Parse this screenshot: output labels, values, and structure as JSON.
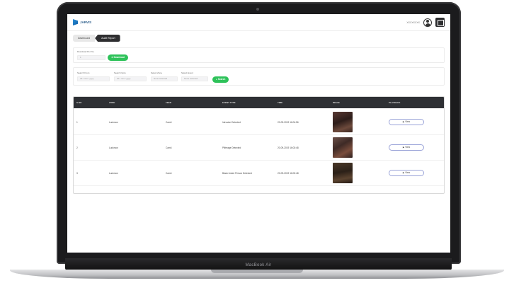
{
  "device": {
    "brand": "MacBook Air"
  },
  "app": {
    "name": "JARVIS",
    "user_label": "XXXXXXXX"
  },
  "breadcrumb": {
    "items": [
      "Dashboard",
      "Audit Report"
    ]
  },
  "download": {
    "label": "Download Per No.",
    "value": "1",
    "button": "Download"
  },
  "filters": {
    "start_date": {
      "label": "Search From",
      "placeholder": "dd / mm / yyyy"
    },
    "end_date": {
      "label": "Search Upto",
      "placeholder": "dd / mm / yyyy"
    },
    "select_zone": {
      "label": "Select Zone",
      "value": "None selected"
    },
    "select_event": {
      "label": "Select Event",
      "value": "None selected"
    },
    "search_button": "Search"
  },
  "table": {
    "headers": [
      "S.NO",
      "ZONE",
      "FEED",
      "EVENT TYPE",
      "TIME",
      "IMAGE",
      "PLAYBACK"
    ],
    "rows": [
      {
        "sno": "1",
        "zone": "Lucknow",
        "feed": "Cam4",
        "event": "Intrusion Detected",
        "time": "20-09-2019 16:04:56",
        "view": "View"
      },
      {
        "sno": "2",
        "zone": "Lucknow",
        "feed": "Cam4",
        "event": "Pilferage Detected",
        "time": "20-09-2019 16:03:48",
        "view": "View"
      },
      {
        "sno": "3",
        "zone": "Lucknow",
        "feed": "Cam4",
        "event": "Black Listed Person Detected",
        "time": "20-09-2019 16:03:48",
        "view": "View"
      }
    ]
  },
  "colors": {
    "accent_green": "#2ec25a",
    "header_dark": "#2e3034",
    "view_border": "#9aa3d8"
  }
}
